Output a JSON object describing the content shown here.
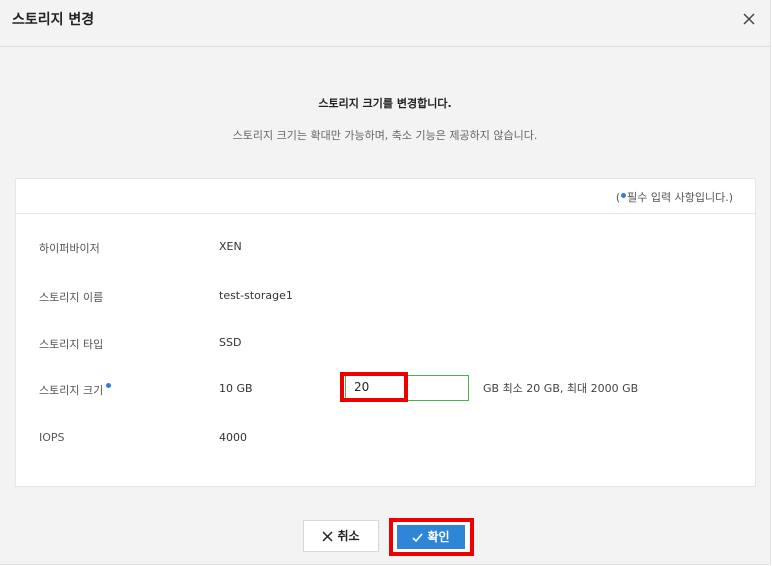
{
  "dialog": {
    "title": "스토리지 변경",
    "close_icon": "close-icon"
  },
  "intro": {
    "title": "스토리지 크기를 변경합니다.",
    "description": "스토리지 크기는 확대만 가능하며, 축소 기능은 제공하지 않습니다."
  },
  "form": {
    "required_note_prefix": "(",
    "required_note_text": "필수 입력 사항입니다.)",
    "rows": [
      {
        "label": "하이퍼바이저",
        "value": "XEN"
      },
      {
        "label": "스토리지 이름",
        "value": "test-storage1"
      },
      {
        "label": "스토리지 타입",
        "value": "SSD"
      },
      {
        "label": "스토리지 크기",
        "value": "10 GB"
      },
      {
        "label": "IOPS",
        "value": "4000"
      }
    ],
    "size_input_value": "20",
    "size_hint": "GB 최소 20 GB, 최대 2000 GB"
  },
  "buttons": {
    "cancel_label": "취소",
    "confirm_label": "확인"
  },
  "colors": {
    "accent": "#2f86d6",
    "required_dot": "#2f7ed8",
    "highlight": "#ee0000",
    "input_border": "#4caf50"
  }
}
